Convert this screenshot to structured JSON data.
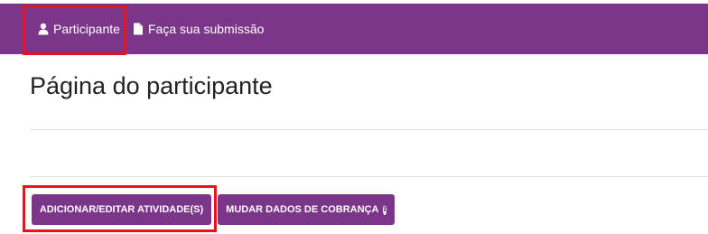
{
  "navbar": {
    "items": [
      {
        "label": "Participante",
        "icon": "user-icon"
      },
      {
        "label": "Faça sua submissão",
        "icon": "file-icon"
      }
    ],
    "background": "#7b3589"
  },
  "main": {
    "title": "Página do participante"
  },
  "actions": {
    "add_edit_label": "ADICIONAR/EDITAR ATIVIDADE(S)",
    "billing_label": "MUDAR DADOS DE COBRANÇA",
    "billing_icon": "info-icon",
    "accent": "#7b3589"
  },
  "highlight_color": "#e2151f"
}
